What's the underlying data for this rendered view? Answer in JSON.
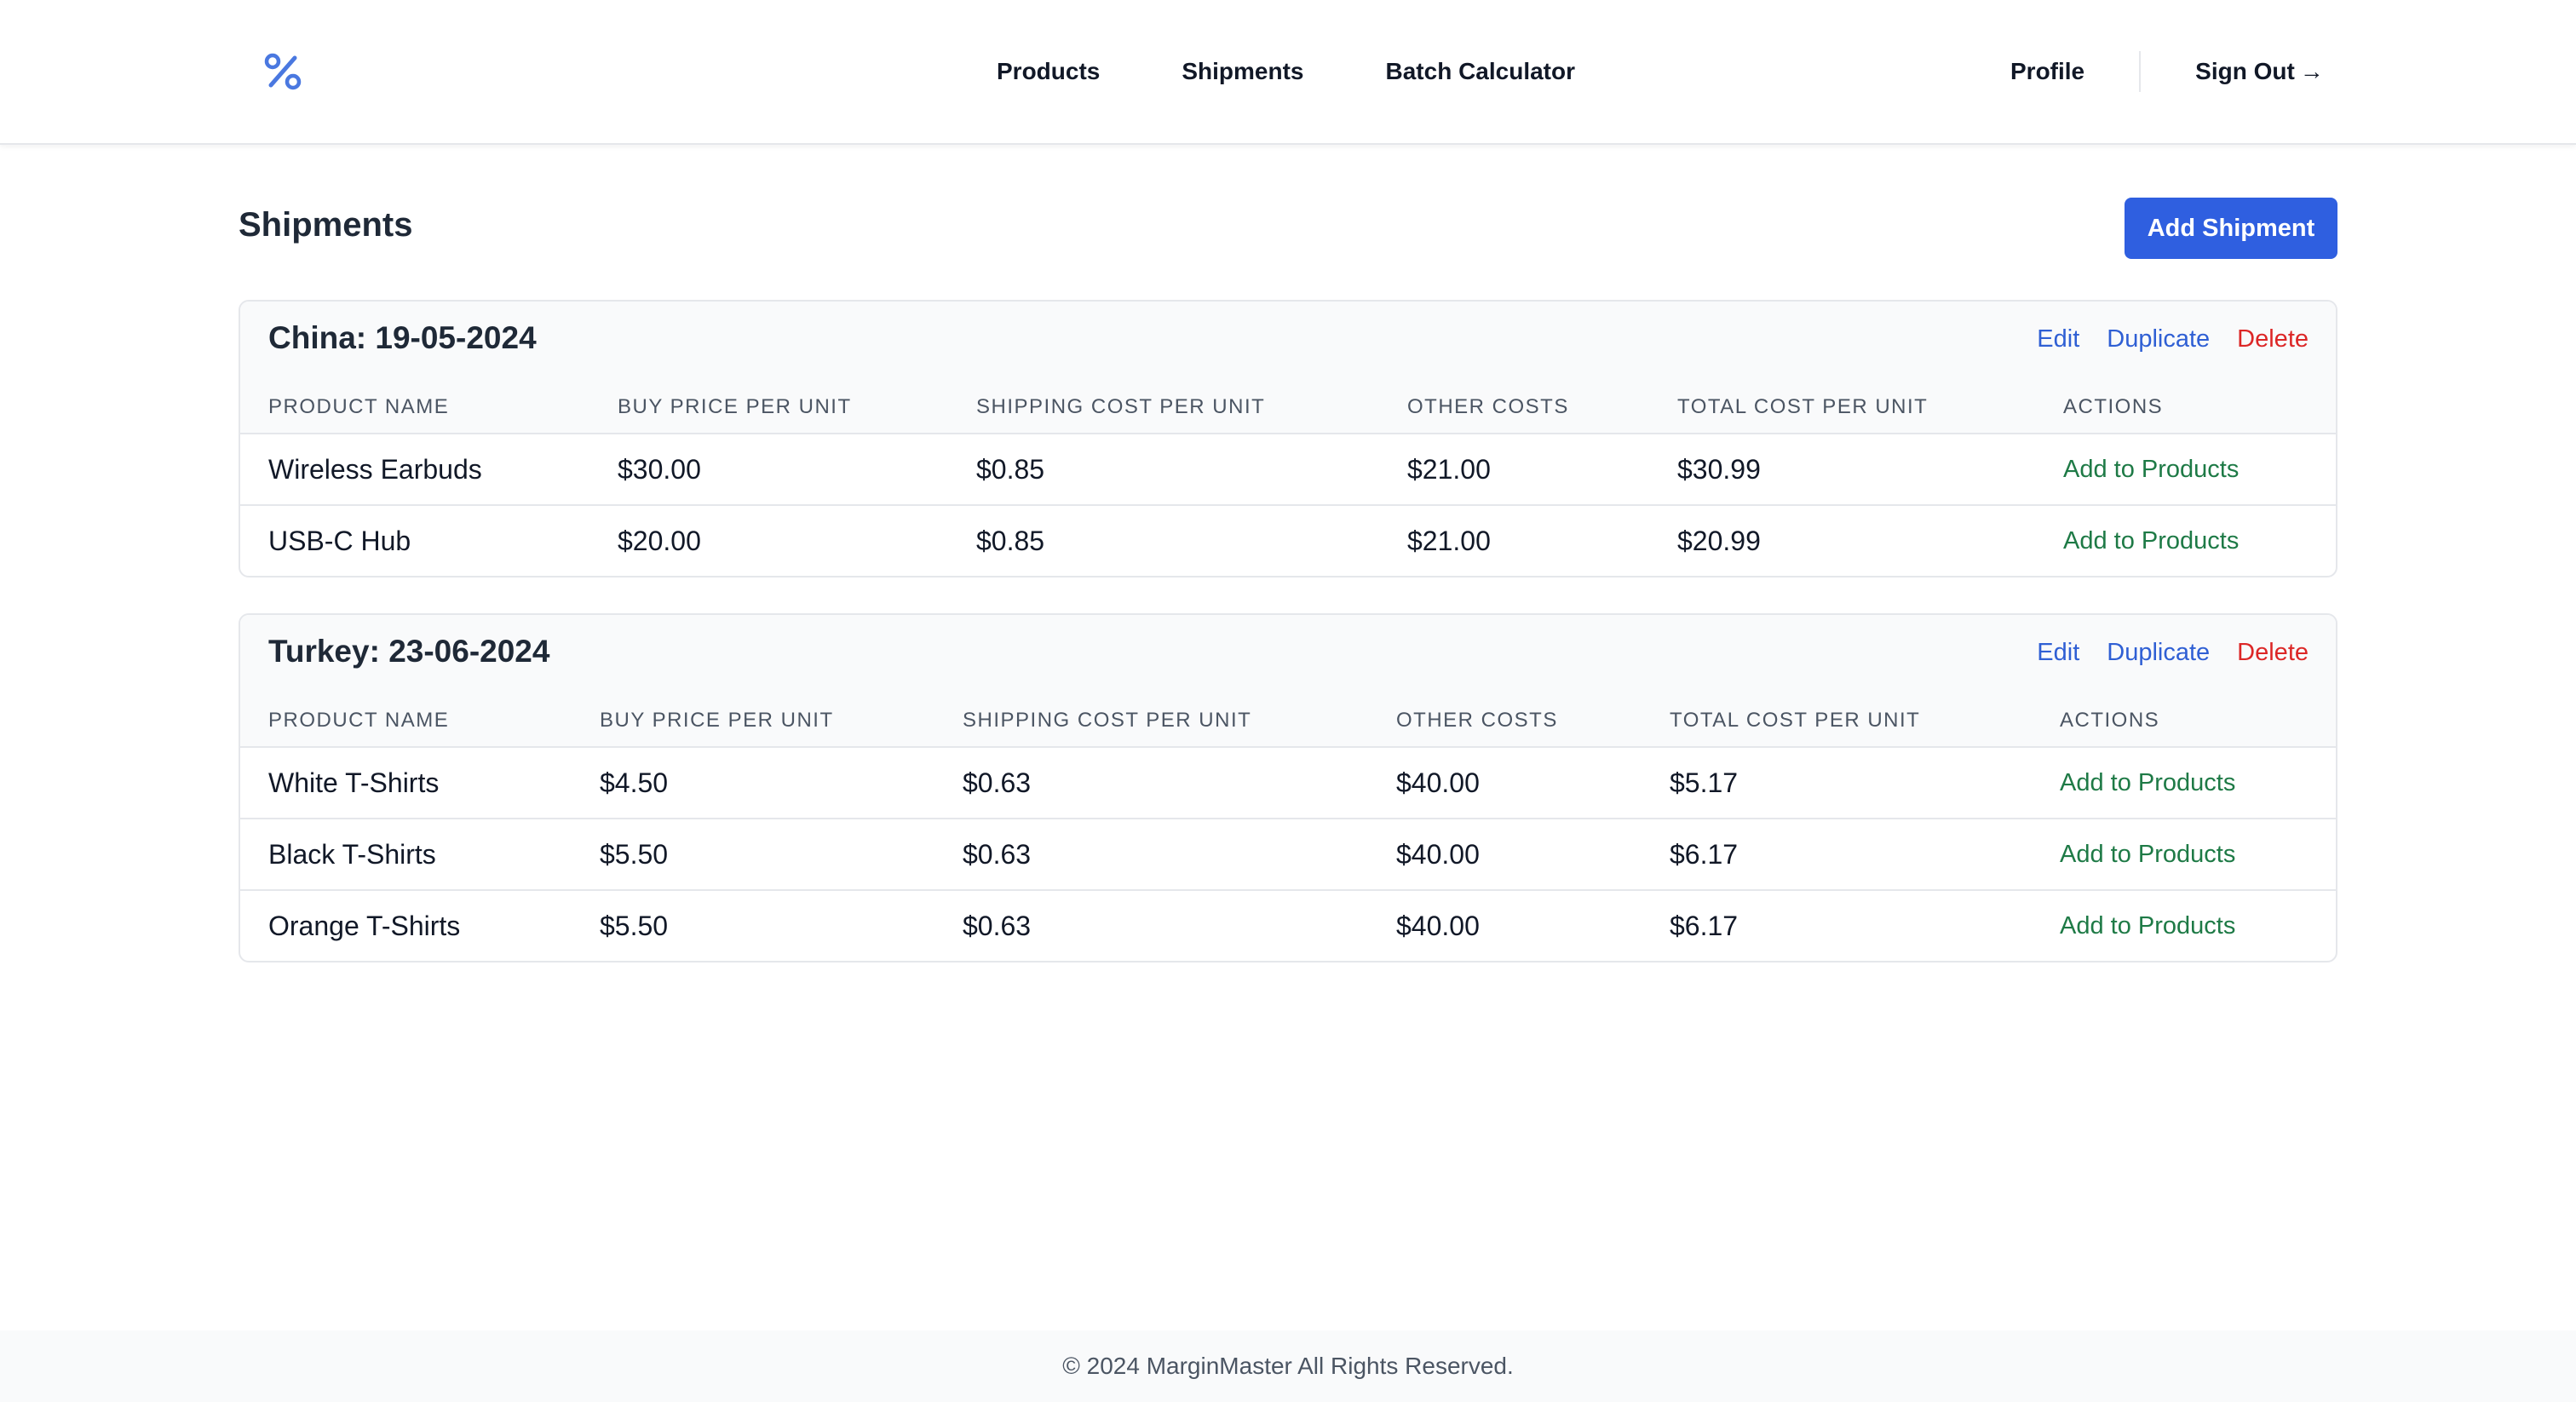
{
  "nav": {
    "logo_icon": "percent-icon",
    "links": [
      "Products",
      "Shipments",
      "Batch Calculator"
    ],
    "profile": "Profile",
    "sign_out": "Sign Out",
    "sign_out_arrow": "→"
  },
  "page": {
    "title": "Shipments",
    "add_button": "Add Shipment"
  },
  "colors": {
    "primary": "#2f5fe0",
    "link_blue": "#2f5fd4",
    "danger": "#dc2626",
    "success": "#1e7a46"
  },
  "columns": [
    "PRODUCT NAME",
    "BUY PRICE PER UNIT",
    "SHIPPING COST PER UNIT",
    "OTHER COSTS",
    "TOTAL COST PER UNIT",
    "ACTIONS"
  ],
  "shipments": [
    {
      "title": "China: 19-05-2024",
      "actions": {
        "edit": "Edit",
        "duplicate": "Duplicate",
        "delete": "Delete"
      },
      "rows": [
        {
          "name": "Wireless Earbuds",
          "buy": "$30.00",
          "shipping": "$0.85",
          "other": "$21.00",
          "total": "$30.99",
          "action": "Add to Products"
        },
        {
          "name": "USB-C Hub",
          "buy": "$20.00",
          "shipping": "$0.85",
          "other": "$21.00",
          "total": "$20.99",
          "action": "Add to Products"
        }
      ]
    },
    {
      "title": "Turkey: 23-06-2024",
      "actions": {
        "edit": "Edit",
        "duplicate": "Duplicate",
        "delete": "Delete"
      },
      "rows": [
        {
          "name": "White T-Shirts",
          "buy": "$4.50",
          "shipping": "$0.63",
          "other": "$40.00",
          "total": "$5.17",
          "action": "Add to Products"
        },
        {
          "name": "Black T-Shirts",
          "buy": "$5.50",
          "shipping": "$0.63",
          "other": "$40.00",
          "total": "$6.17",
          "action": "Add to Products"
        },
        {
          "name": "Orange T-Shirts",
          "buy": "$5.50",
          "shipping": "$0.63",
          "other": "$40.00",
          "total": "$6.17",
          "action": "Add to Products"
        }
      ]
    }
  ],
  "footer": {
    "text": "© 2024 MarginMaster All Rights Reserved."
  }
}
